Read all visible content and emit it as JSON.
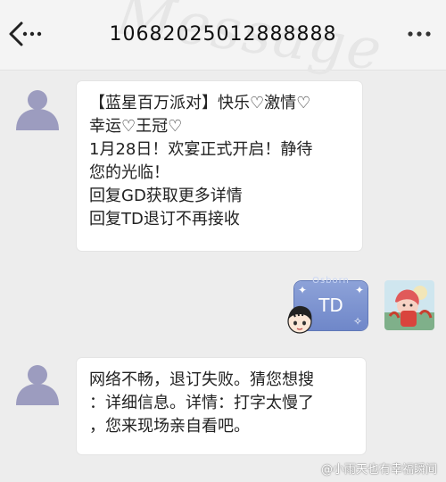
{
  "header": {
    "title": "10682025012888888",
    "watermark": "Message",
    "back_icon": "back-arrow-icon",
    "more_icon": "more-dots-icon"
  },
  "messages": [
    {
      "direction": "incoming",
      "lines": [
        "【蓝星百万派对】快乐♡激情♡",
        "幸运♡王冠♡",
        "1月28日！欢宴正式开启！静待",
        "您的光临！",
        "回复GD获取更多详情",
        "回复TD退订不再接收"
      ]
    },
    {
      "direction": "outgoing",
      "text": "TD",
      "bubble_decoration": "Osborn"
    },
    {
      "direction": "incoming",
      "lines": [
        "网络不畅，退订失败。猜您想搜",
        "：详细信息。详情：打字太慢了",
        "，您来现场亲自看吧。"
      ]
    }
  ],
  "footer": {
    "watermark": "@小雨天也有幸福瞬间"
  },
  "colors": {
    "background": "#ededed",
    "bubble_in": "#ffffff",
    "bubble_out": "#7b91cf",
    "avatar_placeholder": "#9c9cbf"
  }
}
